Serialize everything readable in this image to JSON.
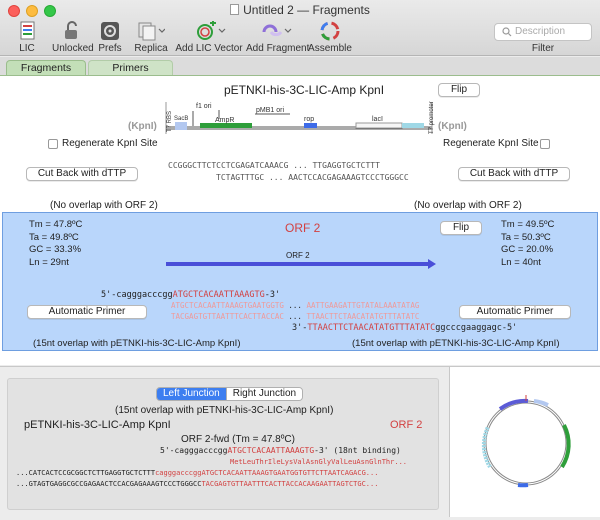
{
  "window": {
    "title": "Untitled 2 — Fragments"
  },
  "toolbar": {
    "lic": "LIC",
    "unlocked": "Unlocked",
    "prefs": "Prefs",
    "replica": "Replica",
    "add_lic_vector": "Add LIC Vector",
    "add_fragment": "Add Fragment",
    "assemble": "Assemble",
    "search_placeholder": "Description",
    "filter": "Filter"
  },
  "tabs": {
    "fragments": "Fragments",
    "primers": "Primers"
  },
  "vector": {
    "name": "pETNKI-his-3C-LIC-Amp KpnI",
    "flip": "Flip",
    "kpni_left": "(KpnI)",
    "kpni_right": "(KpnI)",
    "regenerate_left": "Regenerate KpnI Site",
    "regenerate_right": "Regenerate KpnI Site",
    "cut_back_left": "Cut Back with dTTP",
    "cut_back_right": "Cut Back with dTTP",
    "map_labels": {
      "rbs": "T7 RBS",
      "sacb": "SacB",
      "f1ori": "f1 ori",
      "ampr": "AmpR",
      "pmb1": "pMB1 ori",
      "rop": "rop",
      "laci": "lacI",
      "t7promoter": "T7 promoter"
    },
    "seq_top": "CCGGGCTTCTCCTCGAGATCAAACG ... TTGAGGTGCTCTTT",
    "seq_bottom": "TCTAGTTTGC ... AACTCCACGAGAAAGTCCCTGGGCC",
    "no_overlap_left": "(No overlap with ORF 2)",
    "no_overlap_right": "(No overlap with ORF 2)"
  },
  "orf": {
    "name": "ORF 2",
    "flip": "Flip",
    "arrow_label": "ORF 2",
    "left_stats": [
      "Tm = 47.8ºC",
      "Ta = 49.8ºC",
      "GC = 33.3%",
      "Ln = 29nt"
    ],
    "right_stats": [
      "Tm = 49.5ºC",
      "Ta = 50.3ºC",
      "GC = 20.0%",
      "Ln = 40nt"
    ],
    "fwd_primer_prefix": "5'-cagggacccgg",
    "fwd_primer_main": "ATGCTCACAATTAAAGTG",
    "fwd_primer_suffix": "-3'",
    "seq_top_left": "ATGCTCACAATTAAAGTGAATGGTG",
    "seq_top_right": "AATTGAAGATTGTATALAAATATAG",
    "seq_bot_left": "TACGAGTGTTAATTTCACTTACCAC",
    "seq_bot_right": "TTAACTTCTAACATATGTTTATATC",
    "rev_primer_prefix": "3'-",
    "rev_primer_main": "TTAACTTCTAACATATGTTTATATC",
    "rev_primer_suffix": "ggcccgaaggagc-5'",
    "auto_primer_left": "Automatic Primer",
    "auto_primer_right": "Automatic Primer",
    "overlap_left": "(15nt overlap with pETNKI-his-3C-LIC-Amp KpnI)",
    "overlap_right": "(15nt overlap with pETNKI-his-3C-LIC-Amp KpnI)"
  },
  "junction": {
    "tab_left": "Left Junction",
    "tab_right": "Right Junction",
    "overlap": "(15nt overlap with pETNKI-his-3C-LIC-Amp KpnI)",
    "vector_name": "pETNKI-his-3C-LIC-Amp KpnI",
    "orf_name": "ORF 2",
    "primer_title": "ORF 2-fwd (Tm = 47.8ºC)",
    "primer_prefix": "5'-cagggacccgg",
    "primer_main": "ATGCTCACAATTAAAGTG",
    "primer_suffix": "-3'",
    "binding": "(18nt binding)",
    "protein": "MetLeuThrIleLysValAsnGlyValLeuAsnGlnThr...",
    "seq_top_black": "...CATCACTCCGCGGCTCTTGAGGTGCTCTTT",
    "seq_top_lower": "cagggacccgg",
    "seq_top_red": "ATGCTCACAATTAAAGTGAATGGTGTTCTTAATCAGACG...",
    "seq_bot_black": "...GTAGTGAGGCGCCGAGAACTCCACGAGAAAGTCCCTGGGCC",
    "seq_bot_red": "TACGAGTGTTAATTTCACTTACCACAAGAATTAGTCTGC..."
  },
  "colors": {
    "accent": "#3d7ef0",
    "orf_bg": "#b9d6fb",
    "red": "#d24141",
    "ampr": "#2e9e3a",
    "rop": "#3d6be8",
    "tab": "#c3dfb8"
  }
}
